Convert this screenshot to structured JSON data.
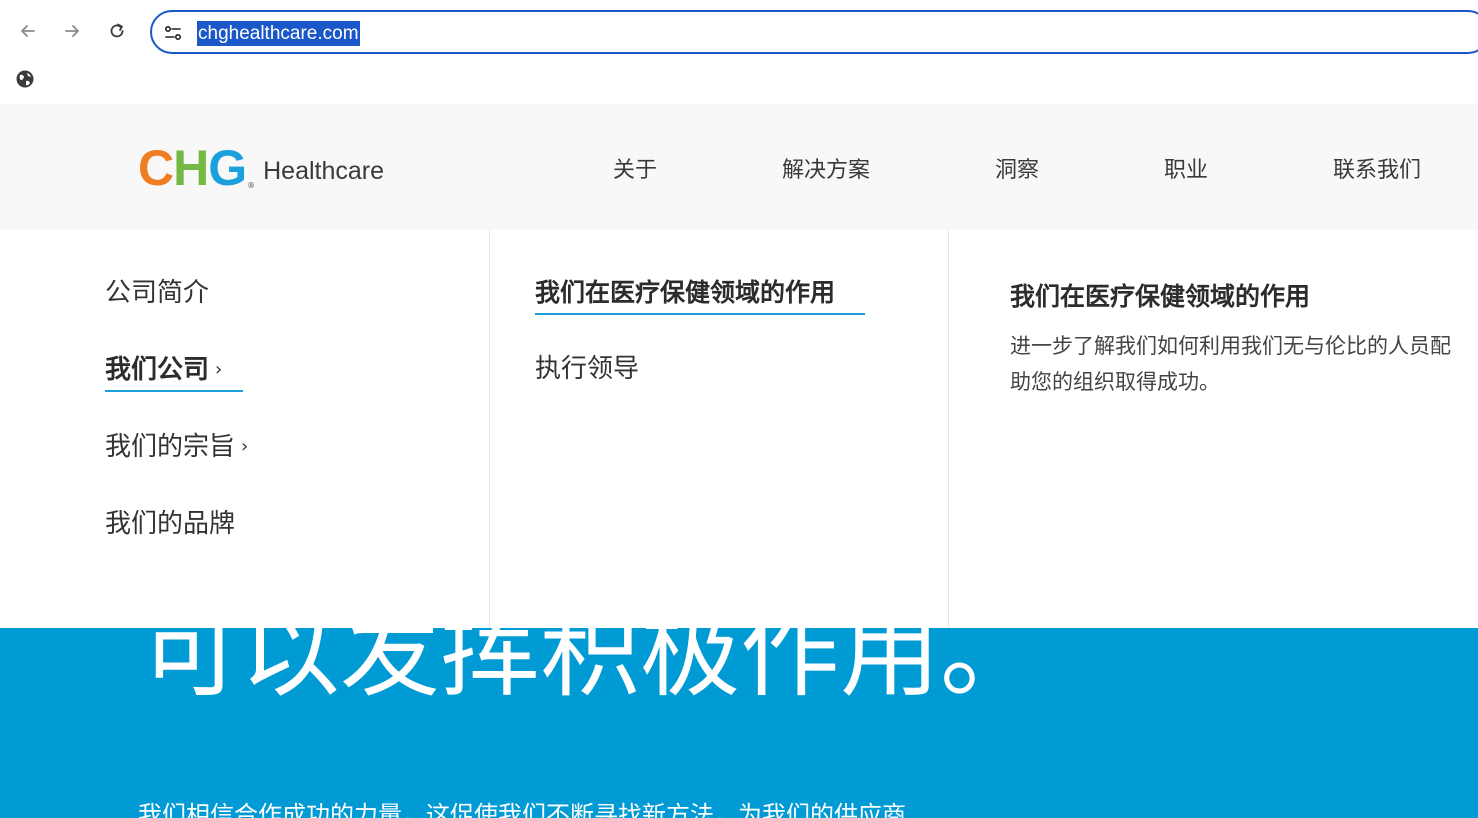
{
  "browser": {
    "url": "chghealthcare.com",
    "icons": {
      "back": "arrow-left-icon",
      "forward": "arrow-right-icon",
      "reload": "reload-icon",
      "site_info": "tune-icon",
      "bookmark": "globe-icon"
    }
  },
  "brand": {
    "logo_c": "C",
    "logo_h": "H",
    "logo_g": "G",
    "logo_reg": "®",
    "wordmark": "Healthcare",
    "colors": {
      "orange": "#ef7d22",
      "green": "#75b843",
      "blue": "#1aa0dc",
      "hero_blue": "#009ad5"
    }
  },
  "main_nav": [
    {
      "label": "关于"
    },
    {
      "label": "解决方案"
    },
    {
      "label": "洞察"
    },
    {
      "label": "职业"
    },
    {
      "label": "联系我们"
    }
  ],
  "mega_menu": {
    "left_column": [
      {
        "label": "公司简介",
        "active": false
      },
      {
        "label": "我们公司",
        "active": true,
        "chevron": "›"
      },
      {
        "label": "我们的宗旨",
        "active": false,
        "chevron": "›"
      },
      {
        "label": "我们的品牌",
        "active": false
      }
    ],
    "middle_column": [
      {
        "label": "我们在医疗保健领域的作用",
        "active": true
      },
      {
        "label": "执行领导",
        "active": false
      }
    ],
    "feature": {
      "title": "我们在医疗保健领域的作用",
      "desc_line1": "进一步了解我们如何利用我们无与伦比的人员配",
      "desc_line2": "助您的组织取得成功。"
    }
  },
  "hero": {
    "heading": "可以发挥积极作用。",
    "subtext": "我们相信合作成功的力量，这促使我们不断寻找新方法，为我们的供应商"
  }
}
